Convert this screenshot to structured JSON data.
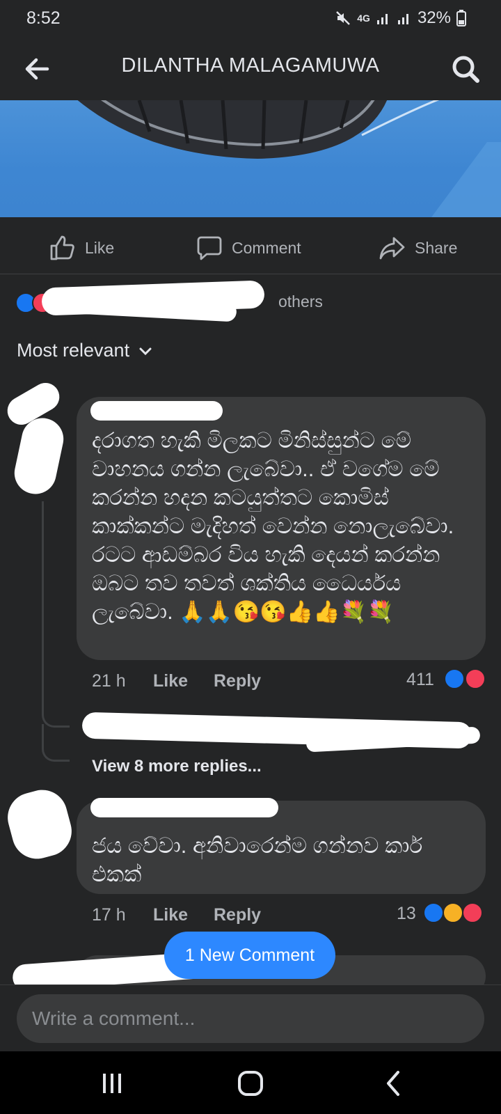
{
  "status_bar": {
    "time": "8:52",
    "network": "4G",
    "battery": "32%",
    "icons": [
      "mute-icon",
      "signal-icon",
      "signal-icon",
      "battery-charging-icon"
    ]
  },
  "header": {
    "title": "DILANTHA MALAGAMUWA",
    "back_icon": "arrow-left-icon",
    "search_icon": "search-icon"
  },
  "actions": {
    "like": "Like",
    "comment": "Comment",
    "share": "Share"
  },
  "reactions_summary": {
    "text_visible": "others"
  },
  "sort": {
    "label": "Most relevant"
  },
  "comments": [
    {
      "text": "දරාගත හැකි මිලකට මිනිස්සුන්ට මේ වාහනය ගන්න ලැබේවා.. ඒ වගේම මේ කරන්න හදන කටයුත්තට කොමිස් කාක්කන්ට මැදිහත් වෙන්න නොලැබේවා. රටට ආඩම්බර විය හැකි දෙයන් කරන්න ඔබට තව තවත් ශක්තිය ධෛර්යය ලැබේවා. 🙏🙏😘😘👍👍💐💐",
      "time": "21 h",
      "like": "Like",
      "reply": "Reply",
      "reaction_count": "411",
      "reactions": [
        "like",
        "love"
      ],
      "view_replies": "View 8 more replies..."
    },
    {
      "text": "ජය වේවා. අනිවාරෙන්ම ගන්නව කාර් එකක්",
      "time": "17 h",
      "like": "Like",
      "reply": "Reply",
      "reaction_count": "13",
      "reactions": [
        "like",
        "care",
        "love"
      ]
    }
  ],
  "new_comment_pill": "1 New Comment",
  "composer": {
    "placeholder": "Write a comment..."
  },
  "colors": {
    "background": "#242526",
    "bubble": "#3a3b3c",
    "accent": "#2d88ff",
    "like_blue": "#1877f2",
    "love_red": "#f33e58"
  }
}
